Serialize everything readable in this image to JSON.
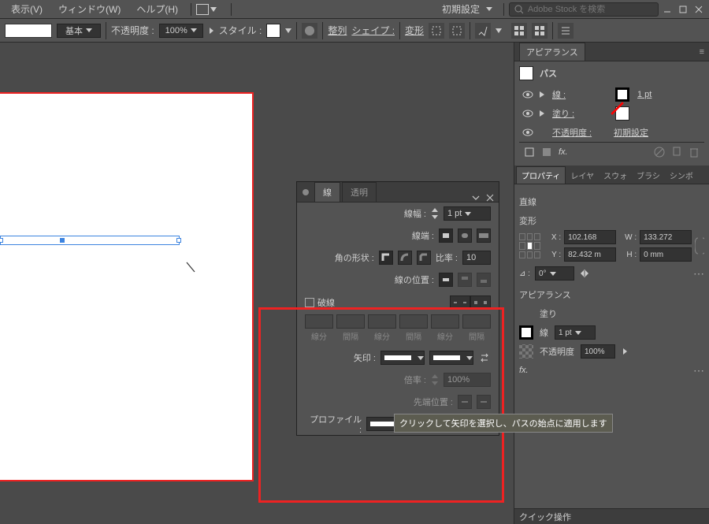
{
  "menu": {
    "view": "表示(V)",
    "window": "ウィンドウ(W)",
    "help": "ヘルプ(H)",
    "workspace": "初期設定",
    "search_placeholder": "Adobe Stock を検索"
  },
  "controlbar": {
    "stroke_preset": "基本",
    "opacity_label": "不透明度 :",
    "opacity_value": "100%",
    "style_label": "スタイル :",
    "align_label": "整列",
    "shape_label": "シェイプ :",
    "transform_label": "変形"
  },
  "stroke_panel": {
    "tab_stroke": "線",
    "tab_transparency": "透明",
    "weight_label": "線幅 :",
    "weight_value": "1 pt",
    "cap_label": "線端 :",
    "corner_label": "角の形状 :",
    "miter_label": "比率 :",
    "miter_value": "10",
    "align_label": "線の位置 :",
    "dash_check": "破線",
    "dash_labels": [
      "線分",
      "間隔",
      "線分",
      "間隔",
      "線分",
      "間隔"
    ],
    "arrow_label": "矢印 :",
    "scale_label": "倍率 :",
    "scale_value": "100%",
    "tip_label": "先端位置 :",
    "profile_label": "プロファイル :",
    "profile_value": "均等"
  },
  "tooltip": "クリックして矢印を選択し、パスの始点に適用します",
  "appearance": {
    "title": "アピアランス",
    "object": "パス",
    "stroke_label": "線 :",
    "stroke_value": "1 pt",
    "fill_label": "塗り :",
    "opacity_label": "不透明度 :",
    "opacity_value": "初期設定",
    "fx": "fx."
  },
  "properties": {
    "tab_properties": "プロパティ",
    "tab_layers": "レイヤ",
    "tab_swatches": "スウォ",
    "tab_brushes": "ブラシ",
    "tab_symbols": "シンボ",
    "object": "直線",
    "transform_label": "変形",
    "x": "102.168",
    "y": "82.432 m",
    "w": "133.272",
    "h": "0 mm",
    "angle": "0°",
    "appear_section": "アピアランス",
    "fill_label": "塗り",
    "stroke_label": "線",
    "stroke_value": "1 pt",
    "opacity_label": "不透明度",
    "opacity_value": "100%",
    "fx": "fx.",
    "quick": "クイック操作"
  }
}
